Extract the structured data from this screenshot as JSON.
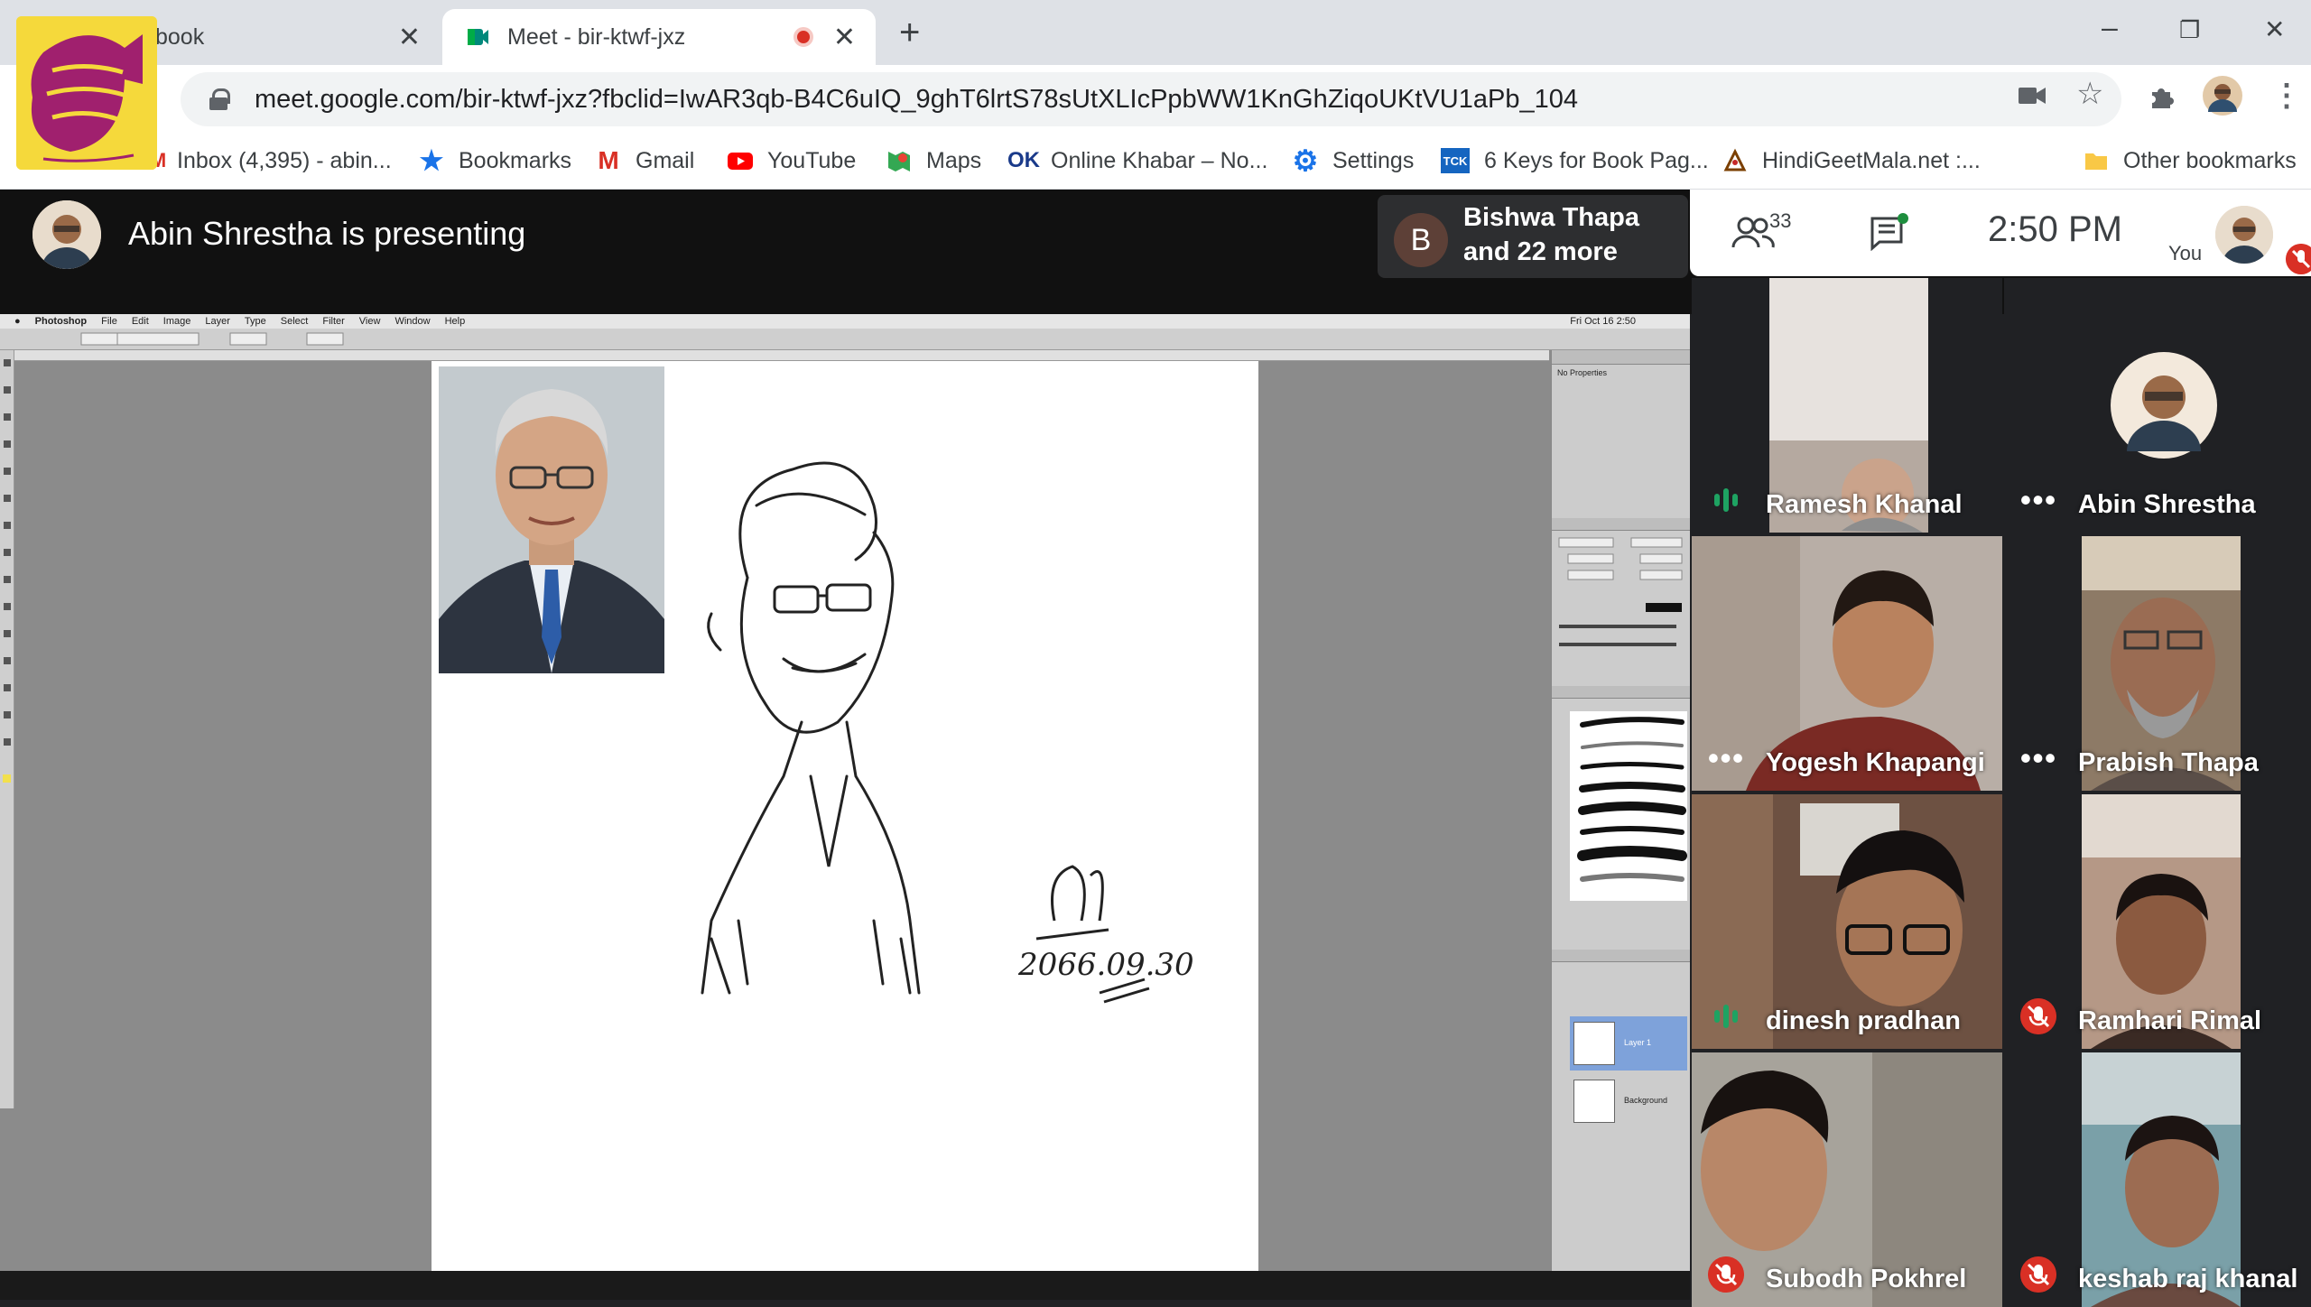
{
  "browser": {
    "tabs": [
      {
        "title": "book",
        "active": false
      },
      {
        "title": "Meet - bir-ktwf-jxz",
        "active": true,
        "recording": true
      }
    ],
    "new_tab": "+",
    "window_controls": {
      "minimize": "–",
      "maximize": "❐",
      "close": "✕"
    },
    "url": "meet.google.com/bir-ktwf-jxz?fbclid=IwAR3qb-B4C6uIQ_9ghT6lrtS78sUtXLIcPpbWW1KnGhZiqoUKtVU1aPb_104",
    "bookmarks": [
      {
        "label": "Inbox (4,395) - abin...",
        "icon": "gmail-icon"
      },
      {
        "label": "Bookmarks",
        "icon": "star-icon"
      },
      {
        "label": "Gmail",
        "icon": "gmail-icon"
      },
      {
        "label": "YouTube",
        "icon": "youtube-icon"
      },
      {
        "label": "Maps",
        "icon": "maps-icon"
      },
      {
        "label": "Online Khabar – No...",
        "icon": "ok-icon"
      },
      {
        "label": "Settings",
        "icon": "gear-icon"
      },
      {
        "label": "6 Keys for Book Pag...",
        "icon": "tck-icon"
      },
      {
        "label": "HindiGeetMala.net :...",
        "icon": "hgm-icon"
      },
      {
        "label": "Other bookmarks",
        "icon": "folder-icon"
      }
    ],
    "tck_badge": "TCK"
  },
  "meet": {
    "presenting_text": "Abin Shrestha is presenting",
    "others": {
      "initial": "B",
      "line1": "Bishwa Thapa",
      "line2": "and 22 more"
    },
    "participant_count": "33",
    "time": "2:50 PM",
    "you_label": "You",
    "participants": [
      {
        "name": "Ramesh Khanal",
        "status": "speaking"
      },
      {
        "name": "Abin Shrestha",
        "status": "dots"
      },
      {
        "name": "Yogesh Khapangi",
        "status": "dots"
      },
      {
        "name": "Prabish Thapa",
        "status": "dots"
      },
      {
        "name": "dinesh pradhan",
        "status": "speaking"
      },
      {
        "name": "Ramhari Rimal",
        "status": "muted"
      },
      {
        "name": "Subodh Pokhrel",
        "status": "muted"
      },
      {
        "name": "keshab raj khanal",
        "status": "muted"
      }
    ]
  },
  "photoshop": {
    "menu": [
      "Photoshop",
      "File",
      "Edit",
      "Image",
      "Layer",
      "Type",
      "Select",
      "Filter",
      "View",
      "Window",
      "Help"
    ],
    "clock": "Fri Oct 16  2:50",
    "panels": {
      "properties": "No Properties",
      "layer1": "Layer 1",
      "background": "Background"
    },
    "sketch_signature": "2066.09.30"
  }
}
